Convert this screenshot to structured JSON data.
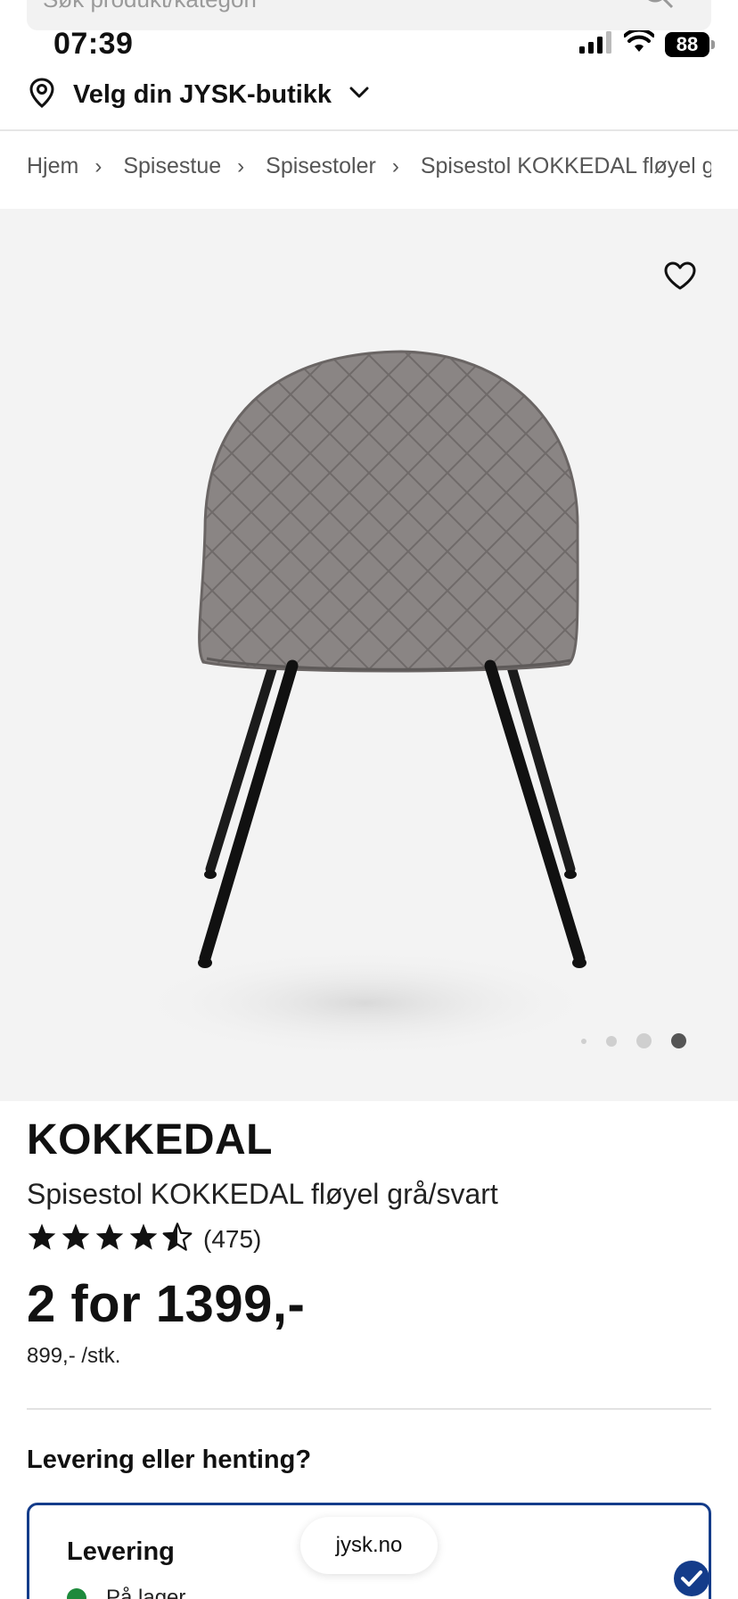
{
  "search": {
    "placeholder": "Søk produkt/kategori"
  },
  "status_bar": {
    "time": "07:39",
    "battery": "88"
  },
  "header": {
    "store_label": "Velg din JYSK-butikk"
  },
  "breadcrumb": [
    "Hjem",
    "Spisestue",
    "Spisestoler",
    "Spisestol KOKKEDAL fløyel grå/svart"
  ],
  "gallery": {
    "image_count": 4,
    "active_index": 3
  },
  "product": {
    "brand": "KOKKEDAL",
    "name": "Spisestol KOKKEDAL fløyel grå/svart",
    "rating": 4.5,
    "review_count": "(475)",
    "price": "2 for 1399,-",
    "unit_price": "899,- /stk."
  },
  "delivery": {
    "heading": "Levering eller henting?",
    "option_title": "Levering",
    "stock_status": "På lager"
  },
  "browser": {
    "url": "jysk.no"
  },
  "colors": {
    "accent": "#143C8A",
    "in_stock": "#1e8a3c",
    "media_bg": "#f3f3f3"
  }
}
